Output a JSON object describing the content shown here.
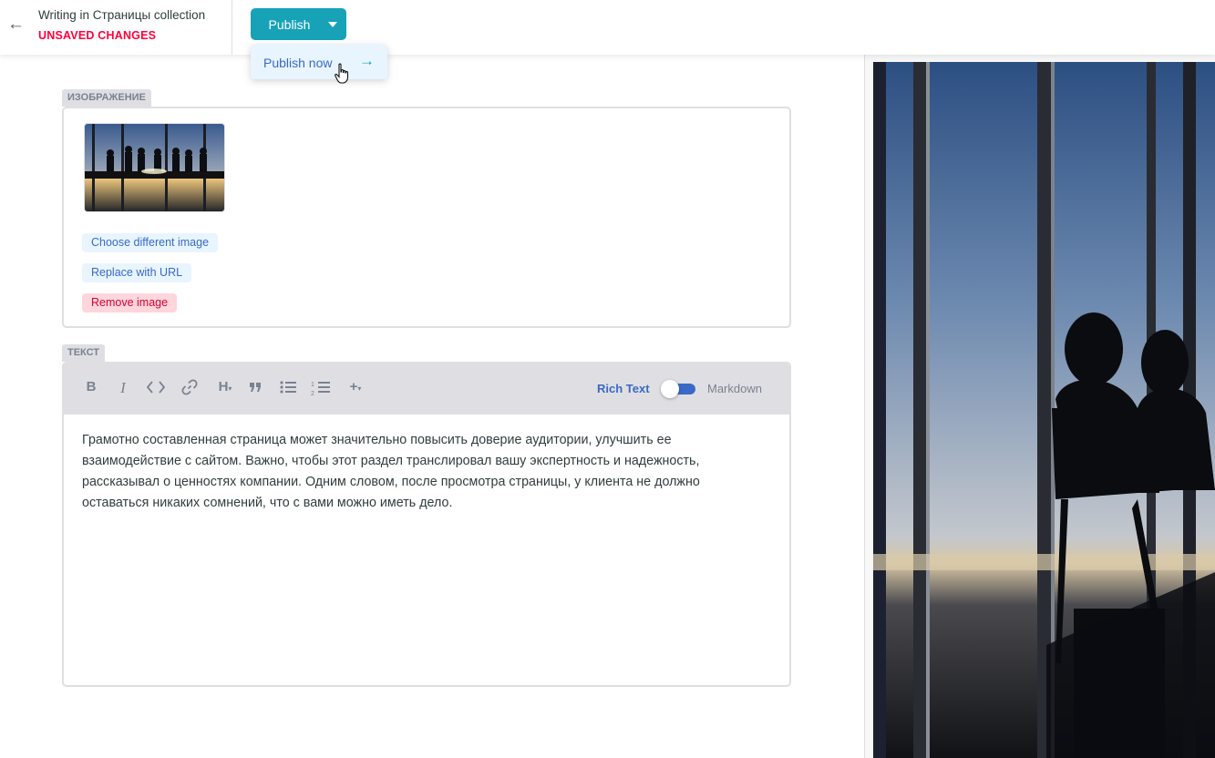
{
  "header": {
    "back_icon": "left-arrow-icon",
    "collection_title": "Writing in Страницы collection",
    "status": "UNSAVED CHANGES",
    "status_color": "#ff003b"
  },
  "publish": {
    "button_label": "Publish",
    "caret_icon": "caret-down-icon",
    "accent": "#17a2b8",
    "dropdown": {
      "item_label": "Publish now",
      "item_icon": "arrow-right-icon"
    }
  },
  "image_field": {
    "label": "ИЗОБРАЖЕНИЕ",
    "choose_label": "Choose different image",
    "replace_label": "Replace with URL",
    "remove_label": "Remove image"
  },
  "text_field": {
    "label": "ТЕКСТ",
    "toolbar": {
      "bold": "B",
      "italic": "I",
      "code_icon": "code-icon",
      "link_icon": "link-icon",
      "heading": "H",
      "quote_icon": "quote-icon",
      "bullet_list_icon": "bulleted-list-icon",
      "numbered_list_icon": "numbered-list-icon",
      "add_icon": "plus-icon"
    },
    "mode_rich": "Rich Text",
    "mode_markdown": "Markdown",
    "rich_text_enabled": true,
    "content": "Грамотно составленная страница может значительно повысить доверие аудитории, улучшить ее взаимодействие с сайтом. Важно, чтобы этот раздел транслировал вашу экспертность и надежность, рассказывал о ценностях компании. Одним словом, после просмотра страницы, у клиента не должно оставаться никаких сомнений, что с вами можно иметь дело."
  },
  "preview": {
    "image_desc_icon": "preview-image"
  }
}
